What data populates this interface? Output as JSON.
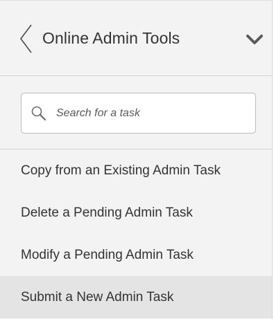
{
  "header": {
    "title": "Online Admin Tools",
    "back_icon": "chevron-left-icon",
    "collapse_icon": "chevron-down-icon"
  },
  "search": {
    "placeholder": "Search for a task",
    "value": "",
    "icon": "search-icon"
  },
  "tasks": [
    {
      "label": "Copy from an Existing Admin Task",
      "selected": false
    },
    {
      "label": "Delete a Pending Admin Task",
      "selected": false
    },
    {
      "label": "Modify a Pending Admin Task",
      "selected": false
    },
    {
      "label": "Submit a New Admin Task",
      "selected": true
    }
  ],
  "colors": {
    "panel_background": "#f3f3f3",
    "selected_row": "#e4e4e4",
    "text": "#333333",
    "divider": "#d4d4d4"
  }
}
